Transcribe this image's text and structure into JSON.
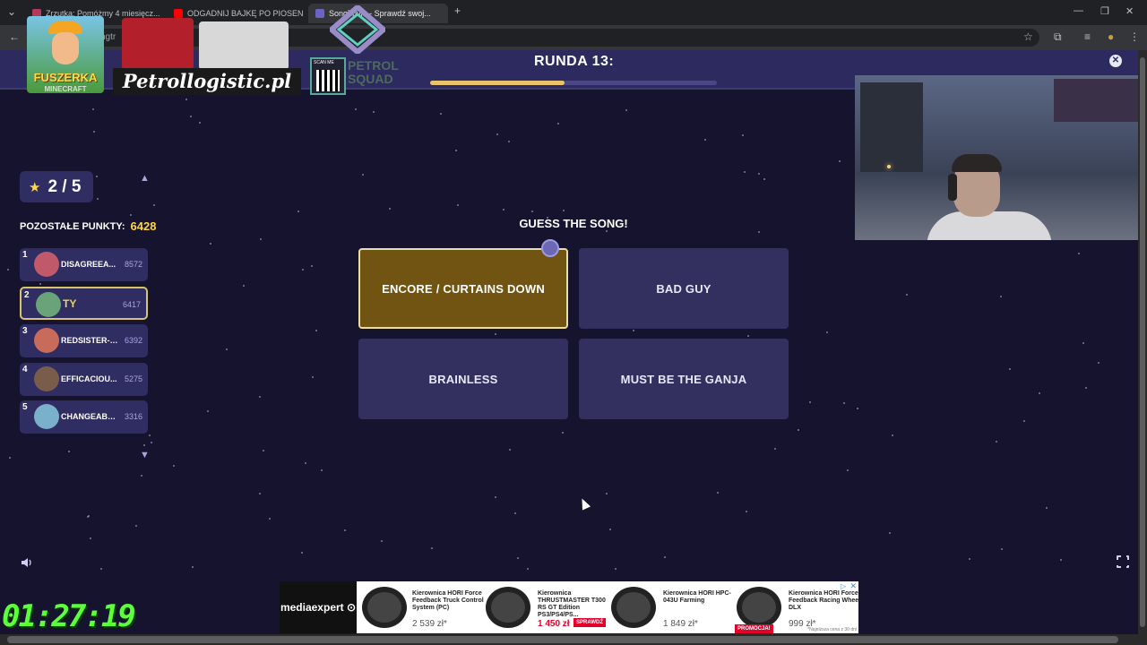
{
  "browser": {
    "tabs": [
      {
        "title": "Zrzutka: Pomóżmy 4 miesięcz...",
        "favicon_color": "#b23a5a"
      },
      {
        "title": "ODGADNIJ BAJKĘ PO PIOSENC...",
        "favicon_color": "#ff0000"
      },
      {
        "title": "SongTrivia - Sprawdź swoj...",
        "favicon_color": "#6c63c7"
      }
    ],
    "new_tab_label": "+",
    "address_text": "ngtr"
  },
  "overlay": {
    "fuszerka_title": "FUSZERKA",
    "fuszerka_sub": "MINECRAFT",
    "petrol_logo": "Petrollogistic.pl",
    "squad_line1": "PETROL",
    "squad_line2": "SQUAD",
    "qr_label": "SCAN ME"
  },
  "game": {
    "round_label": "RUNDA 13:",
    "round_progress": 0.47,
    "score": "2 / 5",
    "points_label": "POZOSTAŁE PUNKTY:",
    "points_value": "6428",
    "question": "GUESS THE SONG!",
    "answers": [
      {
        "label": "ENCORE / CURTAINS DOWN",
        "selected": true
      },
      {
        "label": "BAD GUY",
        "selected": false
      },
      {
        "label": "BRAINLESS",
        "selected": false
      },
      {
        "label": "MUST BE THE GANJA",
        "selected": false
      }
    ],
    "leaderboard": [
      {
        "rank": "1",
        "name": "DISAGREEA...",
        "score": "8572",
        "avatar_color": "#c05a6a",
        "me": false
      },
      {
        "rank": "2",
        "name": "TY",
        "score": "6417",
        "avatar_color": "#6aa37a",
        "me": true
      },
      {
        "rank": "3",
        "name": "REDSISTER-I...",
        "score": "6392",
        "avatar_color": "#c96b5a",
        "me": false
      },
      {
        "rank": "4",
        "name": "EFFICACIOU...",
        "score": "5275",
        "avatar_color": "#7a5c4a",
        "me": false
      },
      {
        "rank": "5",
        "name": "CHANGEABL...",
        "score": "3316",
        "avatar_color": "#7ab0c9",
        "me": false
      }
    ]
  },
  "timer": "01:27:19",
  "ad": {
    "brand": "mediaexpert",
    "products": [
      {
        "title": "Kierownica HORI Force Feedback Truck Control System (PC)",
        "price": "2 539 zł*",
        "badge": ""
      },
      {
        "title": "Kierownica THRUSTMASTER T300 RS GT Edition PS3/PS4/PS...",
        "price": "1 450 zł",
        "badge": "SPRAWDŹ"
      },
      {
        "title": "Kierownica HORI HPC-043U Farming",
        "price": "1 849 zł*",
        "badge": "PROMOCJA!"
      },
      {
        "title": "Kierownica HORI Force Feedback Racing Wheel DLX",
        "price": "999 zł*",
        "badge": ""
      }
    ],
    "note": "*Najniższa cena z 30 dni"
  },
  "colors": {
    "background": "#15132e",
    "panel": "#33305f",
    "selected": "#715411",
    "accent": "#ffd54a",
    "timer": "#5dff3a"
  }
}
